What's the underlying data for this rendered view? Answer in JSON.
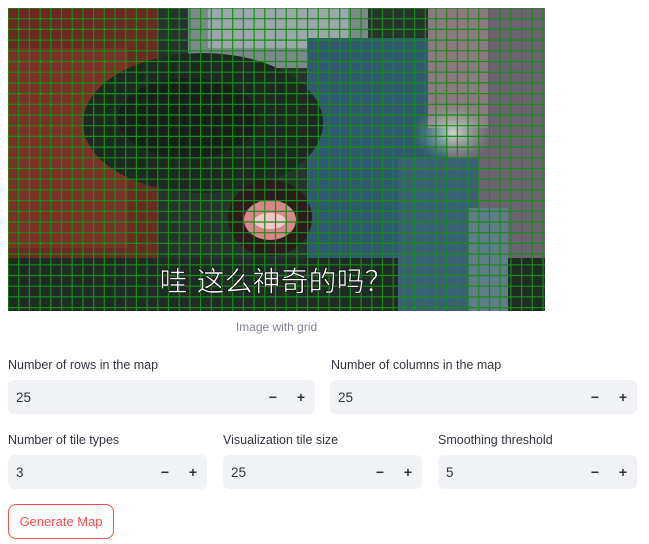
{
  "image": {
    "overlay_text": "哇 这么神奇的吗？",
    "grid_color": "#1a8a1a",
    "caption": "Image with grid"
  },
  "fields": {
    "rows": {
      "label": "Number of rows in the map",
      "value": "25"
    },
    "cols": {
      "label": "Number of columns in the map",
      "value": "25"
    },
    "tile_types": {
      "label": "Number of tile types",
      "value": "3"
    },
    "tile_size": {
      "label": "Visualization tile size",
      "value": "25"
    },
    "smoothing": {
      "label": "Smoothing threshold",
      "value": "5"
    }
  },
  "stepper": {
    "minus": "−",
    "plus": "+"
  },
  "button": {
    "label": "Generate Map"
  },
  "colors": {
    "accent": "#ff4b4b",
    "input_bg": "#f0f2f6"
  }
}
